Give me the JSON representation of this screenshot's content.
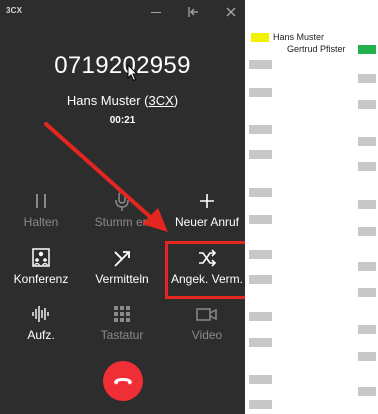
{
  "window": {
    "app_logo": "3CX"
  },
  "call": {
    "number": "0719202959",
    "caller_name": "Hans Muster",
    "caller_link": "3CX",
    "duration": "00:21"
  },
  "buttons": {
    "hold": "Halten",
    "mute": "Stumm en",
    "new_call": "Neuer Anruf",
    "conference": "Konferenz",
    "transfer": "Vermitteln",
    "attended_transfer": "Angek. Verm.",
    "record": "Aufz.",
    "keypad": "Tastatur",
    "video": "Video"
  },
  "legend": {
    "items": [
      {
        "label": "Hans Muster",
        "color": "#f3f000"
      },
      {
        "label": "Gertrud Pfister",
        "color": "#22b14c"
      }
    ]
  },
  "colors": {
    "phone_bg": "#2d2d2d",
    "hangup": "#ef2e35",
    "annotation": "#e3261f"
  }
}
